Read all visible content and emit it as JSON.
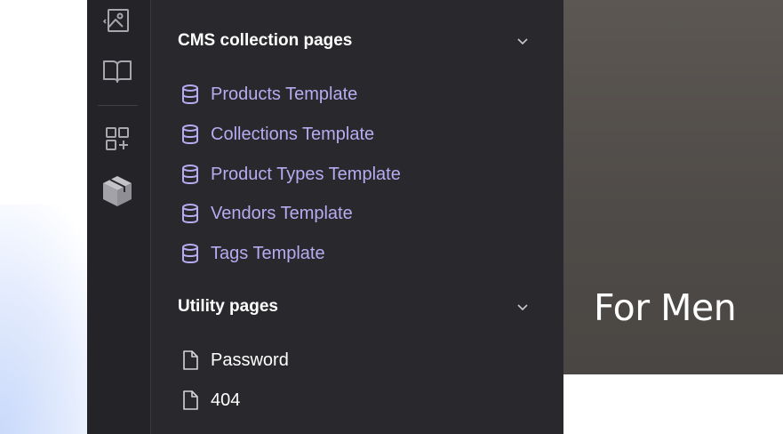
{
  "colors": {
    "sidebar_bg": "#29282c",
    "rail_bg": "#242327",
    "cms_link": "#b7acf2",
    "text": "#ffffff",
    "preview_bg": "#55514d"
  },
  "rail": {
    "icons": [
      "image-icon",
      "book-icon",
      "apps-add-icon",
      "package-icon"
    ]
  },
  "cms_section": {
    "title": "CMS collection pages",
    "items": [
      {
        "label": "Products Template",
        "icon": "database-icon"
      },
      {
        "label": "Collections Template",
        "icon": "database-icon"
      },
      {
        "label": "Product Types Template",
        "icon": "database-icon"
      },
      {
        "label": "Vendors Template",
        "icon": "database-icon"
      },
      {
        "label": "Tags Template",
        "icon": "database-icon"
      }
    ]
  },
  "utility_section": {
    "title": "Utility pages",
    "items": [
      {
        "label": "Password",
        "icon": "file-icon"
      },
      {
        "label": "404",
        "icon": "file-icon"
      }
    ]
  },
  "preview": {
    "heading": "For Men"
  }
}
